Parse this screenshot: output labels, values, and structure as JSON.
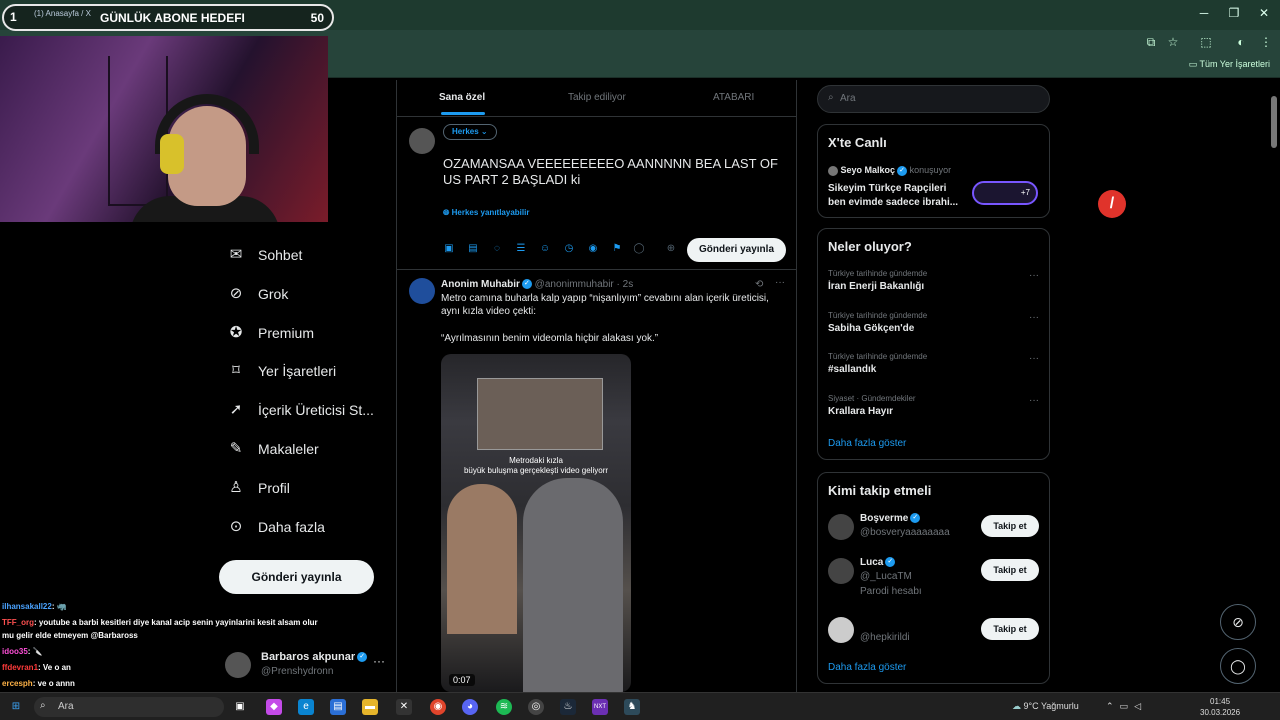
{
  "browser": {
    "tab_title": "(1) Anasayfa / X",
    "bookmarks_folder": "Tüm Yer İşaretleri"
  },
  "overlay": {
    "slot_number": "1",
    "goal_title": "GÜNLÜK ABONE HEDEFI",
    "goal_count": "50"
  },
  "nav": {
    "items": [
      {
        "label": "Sohbet",
        "icon": "envelope-icon"
      },
      {
        "label": "Grok",
        "icon": "grok-icon"
      },
      {
        "label": "Premium",
        "icon": "premium-icon"
      },
      {
        "label": "Yer İşaretleri",
        "icon": "bookmark-icon"
      },
      {
        "label": "İçerik Üreticisi St...",
        "icon": "rocket-icon"
      },
      {
        "label": "Makaleler",
        "icon": "article-icon"
      },
      {
        "label": "Profil",
        "icon": "person-icon"
      },
      {
        "label": "Daha fazla",
        "icon": "more-circle-icon"
      }
    ],
    "post_button": "Gönderi yayınla"
  },
  "account": {
    "name": "Barbaros akpunar",
    "handle": "@Prenshydronn"
  },
  "chat": [
    {
      "user": "ilhansakall22",
      "text": ": 🦏",
      "color": "#4aa3ff"
    },
    {
      "user": "TFF_org",
      "text": ": youtube a barbi kesitleri diye kanal acip senin yayinlarini kesit alsam olur",
      "color": "#ff5050"
    },
    {
      "user": "",
      "text": "mu gelir elde etmeyem @Barbaross",
      "color": "#ffffff"
    },
    {
      "user": "idoo35",
      "text": ": 🔪",
      "color": "#ff4fd8"
    },
    {
      "user": "ffdevran1",
      "text": ": Ve o an",
      "color": "#ff3b3b"
    },
    {
      "user": "ercesph",
      "text": ": ve o annn",
      "color": "#ffb347"
    }
  ],
  "main": {
    "tabs": [
      "Sana özel",
      "Takip ediliyor",
      "ATABARI"
    ],
    "audience": "Herkes",
    "compose_text": "OZAMANSAA  VEEEEEEEEEO AANNNNN BEA LAST OF US PART 2 BAŞLADI  ki",
    "reply_setting": "Herkes yanıtlayabilir",
    "send_button": "Gönderi yayınla",
    "tweet": {
      "author": "Anonim Muhabir",
      "handle": "@anonimmuhabir · 2s",
      "text1": "Metro camına buharla kalp yapıp “nişanlıyım” cevabını alan içerik üreticisi, aynı kızla video çekti:",
      "text2": "“Ayrılmasının benim videomla hiçbir alakası yok.”",
      "video_caption1": "Metrodaki kızla",
      "video_caption2": "büyük buluşma gerçekleşti video geliyorr",
      "duration": "0:07"
    }
  },
  "right": {
    "search_placeholder": "Ara",
    "live": {
      "title": "X'te Canlı",
      "host": "Seyo Malkoç",
      "status": "konuşuyor",
      "line1": "Sikeyim Türkçe Rapçileri",
      "line2": "ben evimde sadece ibrahi...",
      "badge": "+7"
    },
    "trends": {
      "title": "Neler oluyor?",
      "items": [
        {
          "meta": "Türkiye tarihinde gündemde",
          "title": "İran Enerji Bakanlığı"
        },
        {
          "meta": "Türkiye tarihinde gündemde",
          "title": "Sabiha Gökçen'de"
        },
        {
          "meta": "Türkiye tarihinde gündemde",
          "title": "#sallandık"
        },
        {
          "meta": "Siyaset · Gündemdekiler",
          "title": "Krallara Hayır"
        }
      ],
      "more": "Daha fazla göster"
    },
    "follow": {
      "title": "Kimi takip etmeli",
      "items": [
        {
          "name": "Boşverme",
          "handle": "@bosveryaaaaaaaa",
          "extra": ""
        },
        {
          "name": "Luca",
          "handle": "@_LucaTM",
          "extra": "Parodi hesabı"
        },
        {
          "name": "",
          "handle": "@hepkirildi",
          "extra": ""
        }
      ],
      "button": "Takip et",
      "more": "Daha fazla göster"
    }
  },
  "taskbar": {
    "search_placeholder": "Ara",
    "weather": "9°C  Yağmurlu",
    "time": "01:45",
    "date": "30.03.2026"
  }
}
